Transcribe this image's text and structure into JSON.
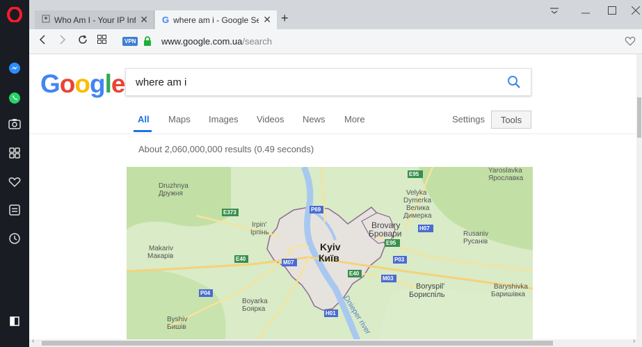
{
  "browser": {
    "tabs": [
      {
        "title": "Who Am I - Your IP Inform",
        "close": "✕"
      },
      {
        "title": "where am i - Google Searc",
        "close": "✕"
      }
    ],
    "new_tab": "+",
    "address": {
      "vpn": "VPN",
      "host": "www.google.com.ua",
      "path": "/search"
    }
  },
  "google": {
    "logo_letters": [
      "G",
      "o",
      "o",
      "g",
      "l",
      "e"
    ],
    "logo_colors": [
      "#4285F4",
      "#EA4335",
      "#FBBC05",
      "#4285F4",
      "#34A853",
      "#EA4335"
    ],
    "query": "where am i",
    "tabs": [
      "All",
      "Maps",
      "Images",
      "Videos",
      "News",
      "More"
    ],
    "settings": "Settings",
    "tools": "Tools",
    "stats": "About 2,060,000,000 results (0.49 seconds)"
  },
  "map": {
    "places": [
      {
        "en": "Yaroslavka",
        "uk": "Ярославка"
      },
      {
        "en": "Druzhnya",
        "uk": "Дружня"
      },
      {
        "en": "Velyka Dymerka",
        "uk": "Велика Димерка"
      },
      {
        "en": "Irpin'",
        "uk": "Ірпінь"
      },
      {
        "en": "Brovary",
        "uk": "Бровари"
      },
      {
        "en": "Rusaniv",
        "uk": "Русанів"
      },
      {
        "en": "Makariv",
        "uk": "Макарів"
      },
      {
        "en": "Kyiv",
        "uk": "Київ"
      },
      {
        "en": "Boryspil'",
        "uk": "Бориспіль"
      },
      {
        "en": "Baryshivka",
        "uk": "Баришівка"
      },
      {
        "en": "Boyarka",
        "uk": "Боярка"
      },
      {
        "en": "Byshiv",
        "uk": "Бишів"
      }
    ],
    "velyka_dymerka_lines": [
      "Velyka",
      "Dymerka",
      "Велика",
      "Димерка"
    ],
    "river": "Dnieper river",
    "roads": [
      "E95",
      "P69",
      "E373",
      "H07",
      "E95",
      "E40",
      "M07",
      "P03",
      "E40",
      "M03",
      "P04",
      "H01"
    ]
  },
  "colors": {
    "sidebar_bg": "#1a1c23",
    "opera_red": "#ff1b2d",
    "link_blue": "#1a73e8",
    "map_green": "#c9e6b4",
    "city_fill": "#e6e3de"
  }
}
